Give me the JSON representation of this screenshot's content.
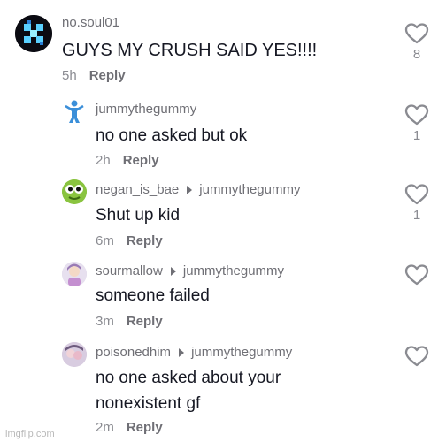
{
  "comments": [
    {
      "username": "no.soul01",
      "reply_to": "",
      "text_lines": [
        "GUYS MY CRUSH SAID YES!!!!"
      ],
      "time": "5h",
      "reply_label": "Reply",
      "like_count": "8"
    },
    {
      "username": "jummythegummy",
      "reply_to": "",
      "text_lines": [
        "no one asked but ok"
      ],
      "time": "2h",
      "reply_label": "Reply",
      "like_count": "1"
    },
    {
      "username": "negan_is_bae",
      "reply_to": "jummythegummy",
      "text_lines": [
        "Shut up kid"
      ],
      "time": "6m",
      "reply_label": "Reply",
      "like_count": "1"
    },
    {
      "username": "sourmallow",
      "reply_to": "jummythegummy",
      "text_lines": [
        "someone failed"
      ],
      "time": "3m",
      "reply_label": "Reply",
      "like_count": ""
    },
    {
      "username": "poisonedhim",
      "reply_to": "jummythegummy",
      "text_lines": [
        "no one asked about your",
        "nonexistent gf"
      ],
      "time": "2m",
      "reply_label": "Reply",
      "like_count": ""
    }
  ],
  "watermark": "imgflip.com",
  "colors": {
    "text": "#161823",
    "secondary": "#8a8b91",
    "username": "#6f6f75"
  }
}
